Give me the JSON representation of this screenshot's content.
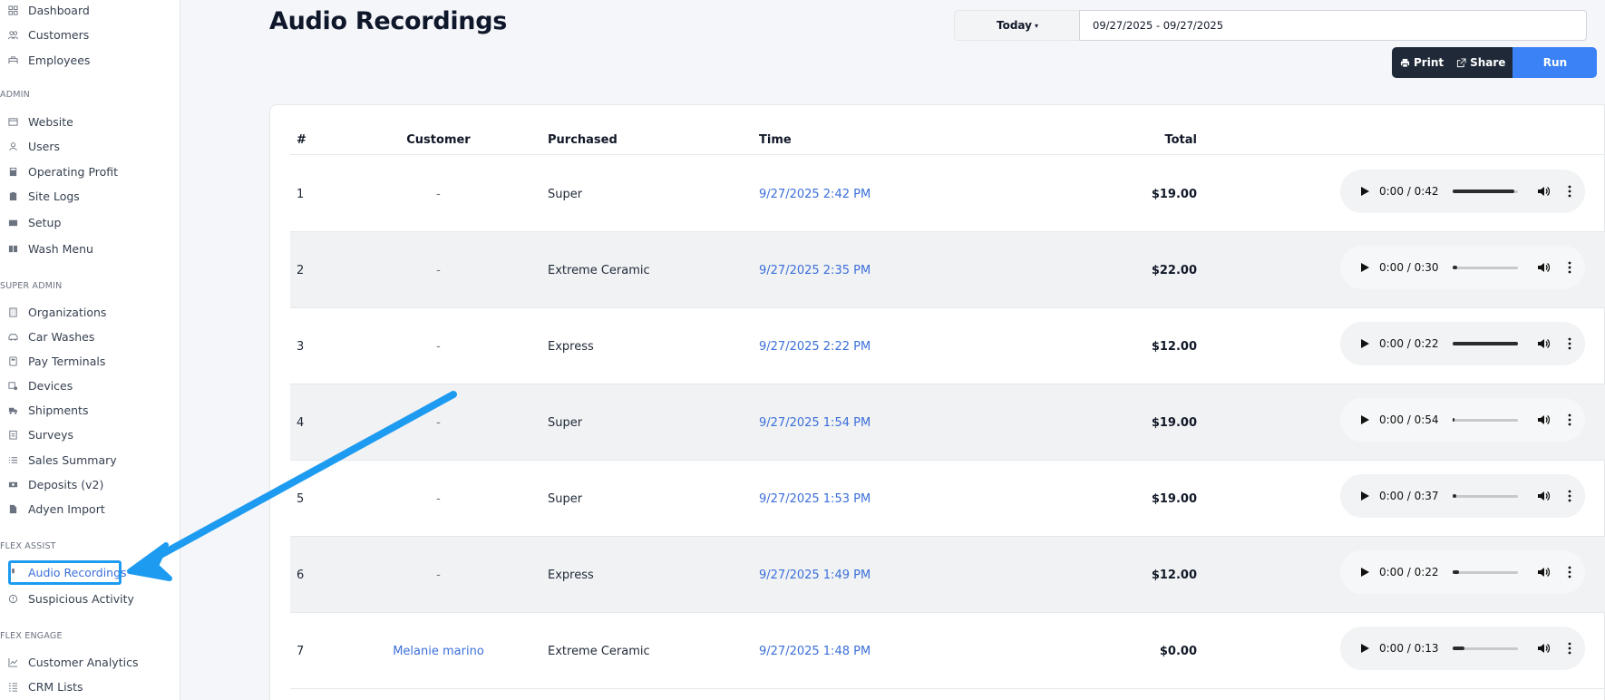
{
  "sidebar": {
    "items_top": [
      {
        "label": "Dashboard",
        "icon": "dashboard-icon"
      },
      {
        "label": "Customers",
        "icon": "users-icon"
      },
      {
        "label": "Employees",
        "icon": "employees-icon"
      }
    ],
    "section_admin": "ADMIN",
    "items_admin": [
      {
        "label": "Website",
        "icon": "browser-icon"
      },
      {
        "label": "Users",
        "icon": "user-icon"
      },
      {
        "label": "Operating Profit",
        "icon": "calculator-icon"
      },
      {
        "label": "Site Logs",
        "icon": "clipboard-icon"
      },
      {
        "label": "Setup",
        "icon": "setup-icon"
      },
      {
        "label": "Wash Menu",
        "icon": "book-icon"
      }
    ],
    "section_super_admin": "SUPER ADMIN",
    "items_super_admin": [
      {
        "label": "Organizations",
        "icon": "building-icon"
      },
      {
        "label": "Car Washes",
        "icon": "car-wash-icon"
      },
      {
        "label": "Pay Terminals",
        "icon": "terminal-icon"
      },
      {
        "label": "Devices",
        "icon": "device-icon"
      },
      {
        "label": "Shipments",
        "icon": "truck-icon"
      },
      {
        "label": "Surveys",
        "icon": "survey-icon"
      },
      {
        "label": "Sales Summary",
        "icon": "list-icon"
      },
      {
        "label": "Deposits (v2)",
        "icon": "money-icon"
      },
      {
        "label": "Adyen Import",
        "icon": "import-icon"
      }
    ],
    "section_flex_assist": "FLEX ASSIST",
    "items_flex_assist": [
      {
        "label": "Audio Recordings",
        "icon": "mic-icon"
      },
      {
        "label": "Suspicious Activity",
        "icon": "alert-icon"
      }
    ],
    "section_flex_engage": "FLEX ENGAGE",
    "items_flex_engage": [
      {
        "label": "Customer Analytics",
        "icon": "chart-icon"
      },
      {
        "label": "CRM Lists",
        "icon": "list-icon"
      }
    ],
    "active_color": "#3b6fd9"
  },
  "header": {
    "title": "Audio Recordings",
    "range_label": "Today",
    "date_range": "09/27/2025 - 09/27/2025",
    "print_label": "Print",
    "share_label": "Share",
    "run_label": "Run"
  },
  "table": {
    "columns": [
      "#",
      "Customer",
      "Purchased",
      "Time",
      "Total"
    ],
    "rows": [
      {
        "num": "1",
        "customer": "-",
        "purchased": "Super",
        "time": "9/27/2025 2:42 PM",
        "total": "$19.00",
        "audio_time": "0:00 / 0:42",
        "played": 0.95
      },
      {
        "num": "2",
        "customer": "-",
        "purchased": "Extreme Ceramic",
        "time": "9/27/2025 2:35 PM",
        "total": "$22.00",
        "audio_time": "0:00 / 0:30",
        "played": 0.07
      },
      {
        "num": "3",
        "customer": "-",
        "purchased": "Express",
        "time": "9/27/2025 2:22 PM",
        "total": "$12.00",
        "audio_time": "0:00 / 0:22",
        "played": 1.0
      },
      {
        "num": "4",
        "customer": "-",
        "purchased": "Super",
        "time": "9/27/2025 1:54 PM",
        "total": "$19.00",
        "audio_time": "0:00 / 0:54",
        "played": 0.03
      },
      {
        "num": "5",
        "customer": "-",
        "purchased": "Super",
        "time": "9/27/2025 1:53 PM",
        "total": "$19.00",
        "audio_time": "0:00 / 0:37",
        "played": 0.05
      },
      {
        "num": "6",
        "customer": "-",
        "purchased": "Express",
        "time": "9/27/2025 1:49 PM",
        "total": "$12.00",
        "audio_time": "0:00 / 0:22",
        "played": 0.1
      },
      {
        "num": "7",
        "customer": "Melanie marino",
        "purchased": "Extreme Ceramic",
        "time": "9/27/2025 1:48 PM",
        "total": "$0.00",
        "audio_time": "0:00 / 0:13",
        "played": 0.18
      }
    ]
  },
  "colors": {
    "link": "#3b6fd9",
    "run": "#3b82f6",
    "dark_button": "#1f2937",
    "annotation": "#1d9bf0"
  }
}
